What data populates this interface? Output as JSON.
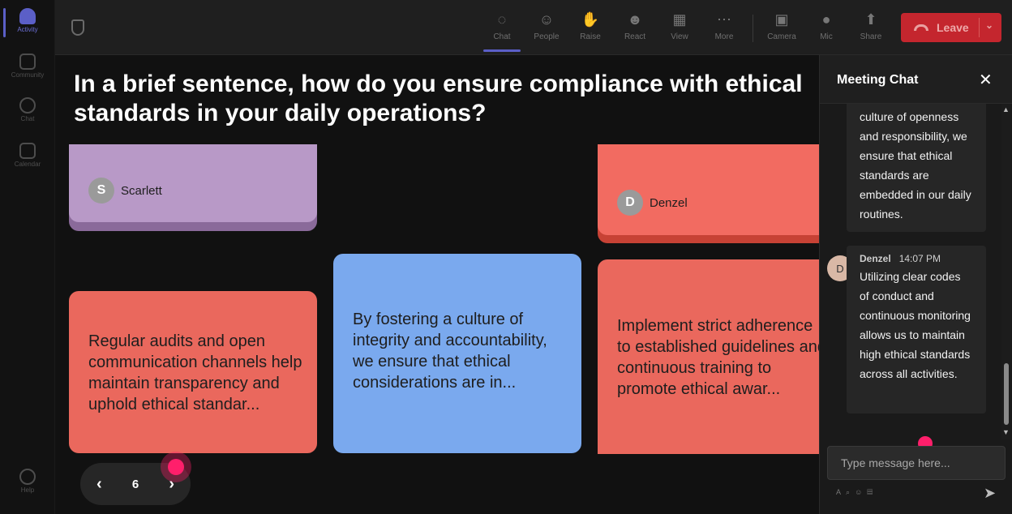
{
  "rail": {
    "items": [
      {
        "label": "Activity"
      },
      {
        "label": "Community"
      },
      {
        "label": "Chat"
      },
      {
        "label": "Calendar"
      },
      {
        "label": "Help"
      }
    ]
  },
  "toolbar": {
    "chat": "Chat",
    "people": "People",
    "raise": "Raise",
    "react": "React",
    "view": "View",
    "more": "More",
    "camera": "Camera",
    "mic": "Mic",
    "share": "Share",
    "leave": "Leave"
  },
  "stage": {
    "question": "In a brief sentence, how do you ensure compliance with ethical standards in your daily operations?",
    "cards": [
      {
        "author": "Scarlett",
        "initial": "S",
        "color": "#b899c7",
        "shadow": "#8a6a9a"
      },
      {
        "author": "Denzel",
        "initial": "D",
        "color": "#f26b61",
        "shadow": "#c74235"
      },
      {
        "text": "Regular audits and open communication channels help maintain transparency and uphold ethical standar...",
        "color": "#ea685d"
      },
      {
        "text": "By fostering a culture of integrity and accountability, we ensure that ethical considerations are in...",
        "color": "#7aa9ee"
      },
      {
        "text": "Implement strict adherence to established guidelines and continuous training to promote ethical awar...",
        "color": "#ea685d"
      }
    ],
    "page": "6"
  },
  "chat": {
    "title": "Meeting Chat",
    "messages": [
      {
        "text": "culture of openness and responsibility, we ensure that ethical standards are embedded in our daily routines."
      },
      {
        "author": "Denzel",
        "time": "14:07 PM",
        "initial": "D",
        "text": "Utilizing clear codes of conduct and continuous monitoring allows us to maintain high ethical standards across all activities."
      }
    ],
    "placeholder": "Type message here..."
  }
}
